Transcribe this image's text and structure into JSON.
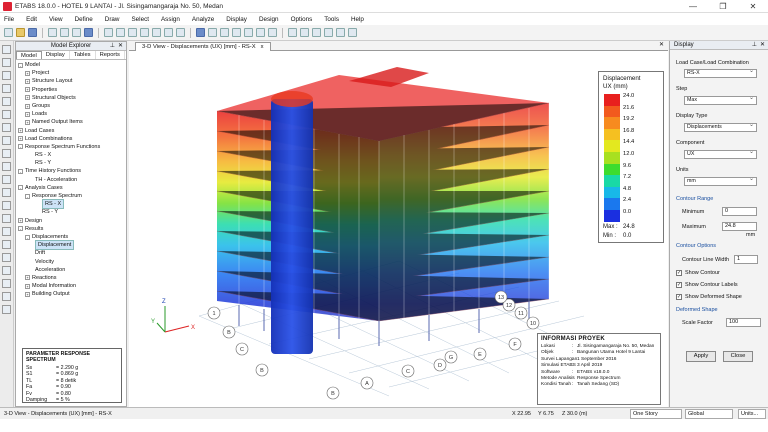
{
  "window": {
    "title": "ETABS 18.0.0 - HOTEL 9 LANTAI - Jl. Sisingamangaraja No. 50, Medan",
    "controls": [
      "—",
      "❐",
      "✕"
    ]
  },
  "menu": [
    "File",
    "Edit",
    "View",
    "Define",
    "Draw",
    "Select",
    "Assign",
    "Analyze",
    "Display",
    "Design",
    "Options",
    "Tools",
    "Help"
  ],
  "explorer": {
    "title": "Model Explorer",
    "tabs": [
      "Model",
      "Display",
      "Tables",
      "Reports"
    ],
    "tree": [
      {
        "label": "Model",
        "indent": 0,
        "box": "-"
      },
      {
        "label": "Project",
        "indent": 1,
        "box": "+"
      },
      {
        "label": "Structure Layout",
        "indent": 1,
        "box": "+"
      },
      {
        "label": "Properties",
        "indent": 1,
        "box": "+"
      },
      {
        "label": "Structural Objects",
        "indent": 1,
        "box": "+"
      },
      {
        "label": "Groups",
        "indent": 1,
        "box": "+"
      },
      {
        "label": "Loads",
        "indent": 1,
        "box": "+"
      },
      {
        "label": "Named Output Items",
        "indent": 1,
        "box": "+"
      },
      {
        "label": "Load Cases",
        "indent": 0,
        "box": "+"
      },
      {
        "label": "Load Combinations",
        "indent": 0,
        "box": "+"
      },
      {
        "label": "Response Spectrum Functions",
        "indent": 0,
        "box": "-"
      },
      {
        "label": "RS - X",
        "indent": 2,
        "box": ""
      },
      {
        "label": "RS - Y",
        "indent": 2,
        "box": ""
      },
      {
        "label": "Time History Functions",
        "indent": 0,
        "box": "-"
      },
      {
        "label": "TH - Acceleration",
        "indent": 2,
        "box": ""
      },
      {
        "label": "Analysis Cases",
        "indent": 0,
        "box": "-"
      },
      {
        "label": "Response Spectrum",
        "indent": 1,
        "box": "-"
      },
      {
        "label": "RS - X",
        "indent": 3,
        "box": "",
        "selected": true
      },
      {
        "label": "RS - Y",
        "indent": 3,
        "box": ""
      },
      {
        "label": "Design",
        "indent": 0,
        "box": "+"
      },
      {
        "label": "Results",
        "indent": 0,
        "box": "-"
      },
      {
        "label": "Displacements",
        "indent": 1,
        "box": "-"
      },
      {
        "label": "Displacement",
        "indent": 2,
        "box": "",
        "selected": true
      },
      {
        "label": "Drift",
        "indent": 2,
        "box": ""
      },
      {
        "label": "Velocity",
        "indent": 2,
        "box": ""
      },
      {
        "label": "Acceleration",
        "indent": 2,
        "box": ""
      },
      {
        "label": "Reactions",
        "indent": 1,
        "box": "+"
      },
      {
        "label": "Modal Information",
        "indent": 1,
        "box": "+"
      },
      {
        "label": "Building Output",
        "indent": 1,
        "box": "+"
      }
    ]
  },
  "params": {
    "title": "PARAMETER RESPONSE SPECTRUM",
    "rows": [
      {
        "k": "Ss",
        "v": "= 2.290 g"
      },
      {
        "k": "S1",
        "v": "= 0.869 g"
      },
      {
        "k": "TL",
        "v": "= 8 detik"
      },
      {
        "k": "Fa",
        "v": "= 0.90"
      },
      {
        "k": "Fv",
        "v": "= 0.80"
      },
      {
        "k": "Damping",
        "v": "= 5 %"
      }
    ]
  },
  "view": {
    "tab": "3-D View - Displacements (UX)  [mm] - RS-X",
    "close": "x"
  },
  "legend": {
    "title1": "Displacement",
    "title2": "UX (mm)",
    "levels": [
      "24.0",
      "21.6",
      "19.2",
      "16.8",
      "14.4",
      "12.0",
      "9.6",
      "7.2",
      "4.8",
      "2.4",
      "0.0"
    ],
    "colors": [
      "#e8201e",
      "#f25a1e",
      "#f78b1f",
      "#f5c021",
      "#e3e81f",
      "#a8e020",
      "#3ddc2e",
      "#19d9a6",
      "#18b8e8",
      "#1a78ee",
      "#1a2fe0"
    ],
    "max_label": "Max :",
    "max_value": "24.8",
    "min_label": "Min :",
    "min_value": "0.0"
  },
  "axes": {
    "z": "Z",
    "y": "Y",
    "x": "X"
  },
  "grid_labels": [
    "1",
    "B",
    "C",
    "B",
    "A",
    "B",
    "C",
    "D",
    "E",
    "F",
    "G",
    "10",
    "11",
    "12",
    "13"
  ],
  "project": {
    "title": "INFORMASI PROYEK",
    "rows": [
      {
        "k": "Lokasi",
        "v": "Jl. Sisingamangaraja No. 50, Medan"
      },
      {
        "k": "Objek",
        "v": "Bangunan Utama Hotel 9 Lantai"
      },
      {
        "k": "Survei Lapangan",
        "v": "1 September 2016"
      },
      {
        "k": "Simulasi ETABS",
        "v": "3 April 2019"
      },
      {
        "k": "Software",
        "v": "ETABS v18.0.0"
      },
      {
        "k": "Metode Analisis",
        "v": "Response Spectrum"
      },
      {
        "k": "Kondisi Tanah",
        "v": "Tanah Sedang (SD)"
      }
    ]
  },
  "display": {
    "title": "Display",
    "load_case_label": "Load Case/Load Combination",
    "load_case": "RS-X",
    "step_label": "Step",
    "step": "Max",
    "display_type_label": "Display Type",
    "display_type": "Displacements",
    "component_label": "Component",
    "component": "UX",
    "units_label": "Units",
    "units": "mm",
    "contour_range_label": "Contour Range",
    "minimum_label": "Minimum",
    "minimum": "0",
    "maximum_label": "Maximum",
    "maximum": "24.8",
    "max_unit": "mm",
    "contour_options_label": "Contour Options",
    "line_width_label": "Contour Line Width",
    "line_width": "1",
    "show_contour": "Show Contour",
    "show_contour_labels": "Show Contour Labels",
    "show_deformed": "Show Deformed Shape",
    "deformed_label": "Deformed Shape",
    "scale_label": "Scale Factor",
    "scale": "100",
    "apply": "Apply",
    "close": "Close"
  },
  "status": {
    "left": "3-D View - Displacements (UX)  [mm] - RS-X",
    "x": "X 22.95",
    "y": "Y 6.75",
    "z": "Z 30.0 (m)",
    "story": "One Story",
    "global": "Global",
    "units": "Units..."
  }
}
